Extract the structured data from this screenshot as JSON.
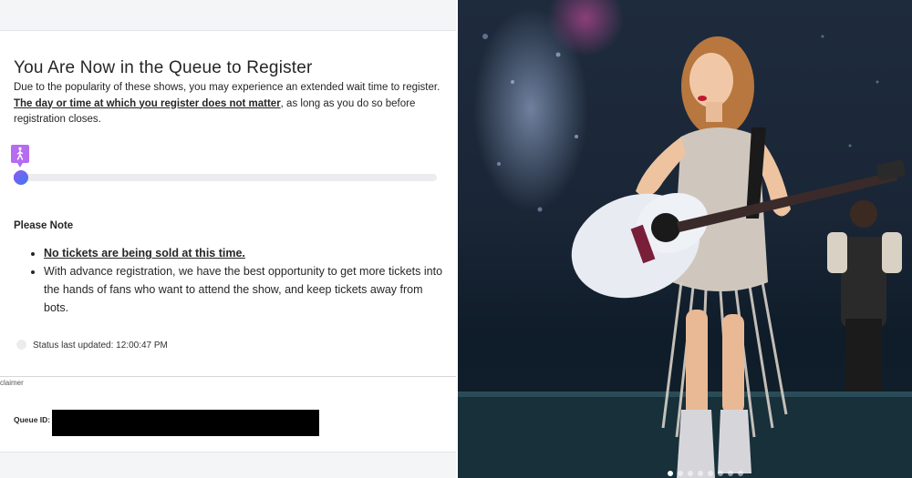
{
  "queue": {
    "title": "You Are Now in the Queue to Register",
    "desc_part1": "Due to the popularity of these shows, you may experience an extended wait time to register. ",
    "desc_strong": "The day or time at which you register does not matter",
    "desc_part2": ", as long as you do so before registration closes.",
    "walker_icon": "walking-person-icon",
    "progress_fraction": 0.01,
    "note_heading": "Please Note",
    "notes": [
      "No tickets are being sold at this time.",
      "With advance registration, we have the best opportunity to get more tickets into the hands of fans who want to attend the show, and keep tickets away from bots."
    ],
    "status_text": "Status last updated: 12:00:47 PM",
    "disclaimer": "claimer",
    "queue_id_label": "Queue ID:",
    "queue_id_value": ""
  },
  "colors": {
    "accent_purple": "#b56cf0",
    "progress_blue": "#5b55e6",
    "text": "#262626",
    "redaction": "#000000"
  },
  "carousel": {
    "dot_count": 8,
    "active_index": 0
  }
}
